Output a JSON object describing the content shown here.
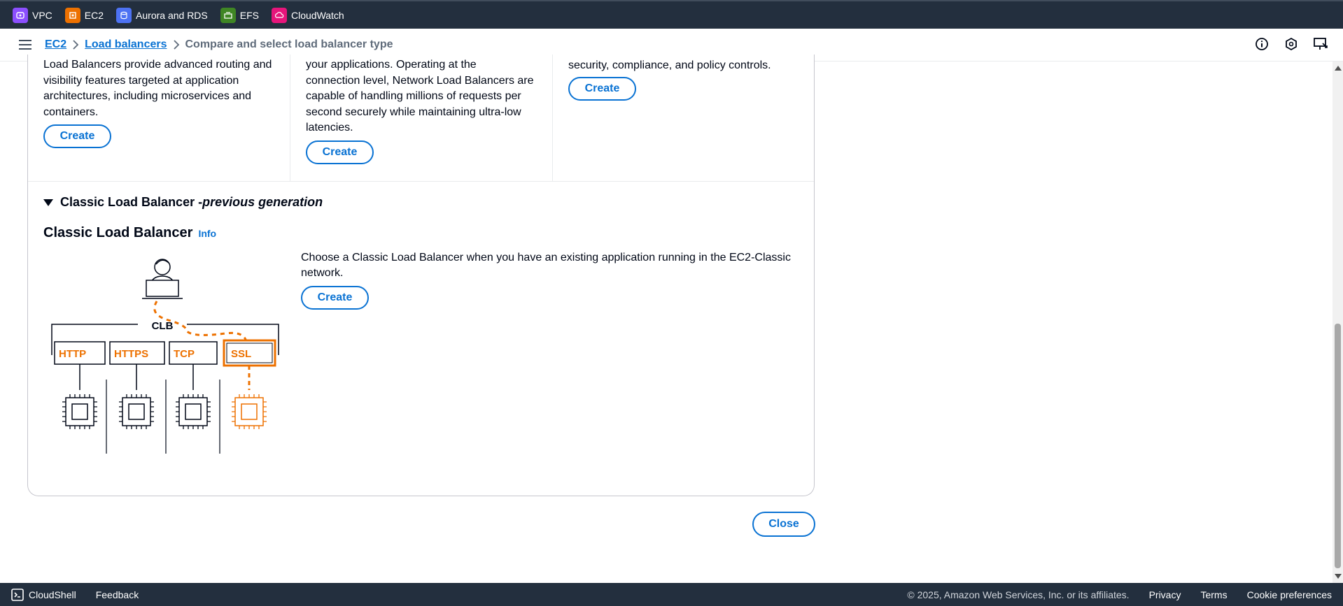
{
  "topbar": {
    "services": [
      {
        "label": "VPC",
        "icon": "vpc-icon",
        "color": "#8c4fff"
      },
      {
        "label": "EC2",
        "icon": "ec2-icon",
        "color": "#ed7100"
      },
      {
        "label": "Aurora and RDS",
        "icon": "rds-icon",
        "color": "#4d72f3"
      },
      {
        "label": "EFS",
        "icon": "efs-icon",
        "color": "#3f8624"
      },
      {
        "label": "CloudWatch",
        "icon": "cloudwatch-icon",
        "color": "#e7157b"
      }
    ]
  },
  "breadcrumb": {
    "items": [
      "EC2",
      "Load balancers"
    ],
    "current": "Compare and select load balancer type"
  },
  "columns": [
    {
      "text_lines": [
        "Load Balancers provide advanced routing and",
        "visibility features targeted at application",
        "architectures, including microservices and",
        "containers."
      ],
      "button": "Create"
    },
    {
      "text_lines": [
        "your applications. Operating at the",
        "connection level, Network Load Balancers are",
        "capable of handling millions of requests per",
        "second securely while maintaining ultra-low",
        "latencies."
      ],
      "button": "Create"
    },
    {
      "text_lines": [
        "security, compliance, and policy controls."
      ],
      "button": "Create"
    }
  ],
  "classic": {
    "expander_title": "Classic Load Balancer - ",
    "expander_sub": "previous generation",
    "heading": "Classic Load Balancer",
    "info": "Info",
    "description": "Choose a Classic Load Balancer when you have an existing application running in the EC2-Classic network.",
    "button": "Create",
    "diagram": {
      "clb_label": "CLB",
      "listeners": [
        "HTTP",
        "HTTPS",
        "TCP",
        "SSL"
      ],
      "highlight_color": "#ed7100"
    }
  },
  "close_button": "Close",
  "footer": {
    "cloudshell": "CloudShell",
    "feedback": "Feedback",
    "copyright": "© 2025, Amazon Web Services, Inc. or its affiliates.",
    "links": [
      "Privacy",
      "Terms",
      "Cookie preferences"
    ]
  }
}
